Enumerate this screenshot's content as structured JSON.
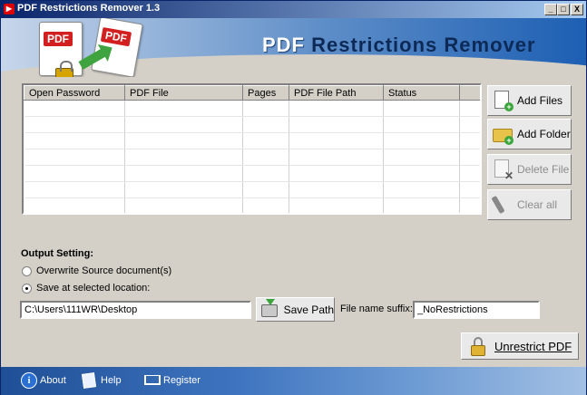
{
  "window": {
    "title": "PDF Restrictions Remover 1.3",
    "buttons": {
      "minimize": "_",
      "maximize": "□",
      "close": "X"
    }
  },
  "banner": {
    "title_part1": "PDF ",
    "title_part2": "Restrictions Remover",
    "icon_label_1": "PDF",
    "icon_label_2": "PDF"
  },
  "table": {
    "columns": [
      "Open Password",
      "PDF File",
      "Pages",
      "PDF File Path",
      "Status",
      ""
    ],
    "rows": [
      [
        "",
        "",
        "",
        "",
        "",
        ""
      ],
      [
        "",
        "",
        "",
        "",
        "",
        ""
      ],
      [
        "",
        "",
        "",
        "",
        "",
        ""
      ],
      [
        "",
        "",
        "",
        "",
        "",
        ""
      ],
      [
        "",
        "",
        "",
        "",
        "",
        ""
      ],
      [
        "",
        "",
        "",
        "",
        "",
        ""
      ],
      [
        "",
        "",
        "",
        "",
        "",
        ""
      ]
    ]
  },
  "side_buttons": {
    "add_files": "Add Files",
    "add_folder": "Add Folder",
    "delete_file": "Delete File",
    "clear_all": "Clear all"
  },
  "output": {
    "heading": "Output Setting:",
    "overwrite_label": "Overwrite Source document(s)",
    "overwrite_checked": false,
    "save_at_label": "Save at selected location:",
    "save_at_checked": true,
    "path_value": "C:\\Users\\111WR\\Desktop",
    "save_path_label": "Save Path",
    "suffix_label": "File name suffix:",
    "suffix_value": "_NoRestrictions"
  },
  "unrestrict_button": "Unrestrict PDF",
  "footer": {
    "about": "About",
    "help": "Help",
    "register": "Register"
  },
  "colors": {
    "window_bg": "#d4d0c8",
    "titlebar_start": "#0a246a",
    "banner_blue": "#1d5fb3",
    "footer_blue": "#3e74bf"
  }
}
